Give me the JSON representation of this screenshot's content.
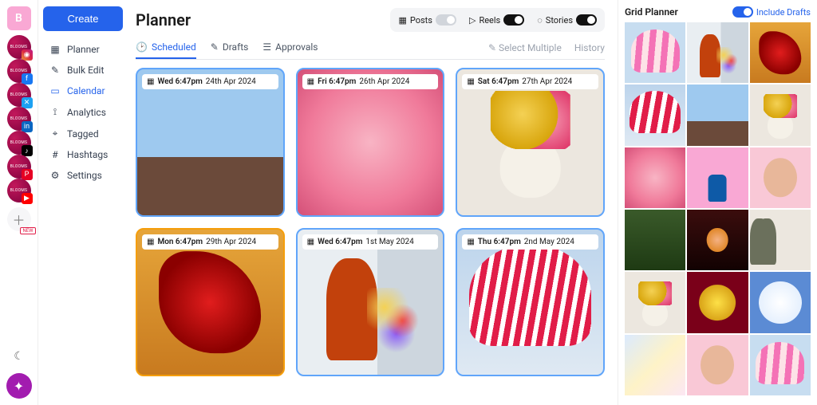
{
  "rail": {
    "avatar_letter": "B",
    "accounts": [
      {
        "name": "blooms-instagram",
        "net": "ig",
        "glyph": "◉"
      },
      {
        "name": "blooms-facebook",
        "net": "fb",
        "glyph": "f"
      },
      {
        "name": "blooms-twitter",
        "net": "tw",
        "glyph": "✕"
      },
      {
        "name": "blooms-linkedin",
        "net": "li",
        "glyph": "in"
      },
      {
        "name": "blooms-tiktok",
        "net": "tk",
        "glyph": "♪"
      },
      {
        "name": "blooms-pinterest",
        "net": "pi",
        "glyph": "P"
      },
      {
        "name": "blooms-youtube",
        "net": "yt",
        "glyph": "▶"
      }
    ],
    "add_badge": "NEW",
    "theme_glyph": "☾",
    "fab_glyph": "✦"
  },
  "sidebar": {
    "create_label": "Create",
    "items": [
      {
        "icon": "▦",
        "label": "Planner",
        "name": "nav-planner"
      },
      {
        "icon": "✎",
        "label": "Bulk Edit",
        "name": "nav-bulk-edit"
      },
      {
        "icon": "▭",
        "label": "Calendar",
        "name": "nav-calendar",
        "active": true
      },
      {
        "icon": "⟟",
        "label": "Analytics",
        "name": "nav-analytics"
      },
      {
        "icon": "⌖",
        "label": "Tagged",
        "name": "nav-tagged"
      },
      {
        "icon": "#",
        "label": "Hashtags",
        "name": "nav-hashtags"
      },
      {
        "icon": "⚙",
        "label": "Settings",
        "name": "nav-settings"
      }
    ]
  },
  "main": {
    "title": "Planner",
    "filters": [
      {
        "icon": "▦",
        "label": "Posts",
        "on": false,
        "name": "filter-posts"
      },
      {
        "icon": "▷",
        "label": "Reels",
        "on": true,
        "name": "filter-reels"
      },
      {
        "icon": "◌",
        "label": "Stories",
        "on": true,
        "name": "filter-stories"
      }
    ],
    "tabs": [
      {
        "icon": "🕑",
        "label": "Scheduled",
        "active": true,
        "name": "tab-scheduled"
      },
      {
        "icon": "✎",
        "label": "Drafts",
        "name": "tab-drafts"
      },
      {
        "icon": "☰",
        "label": "Approvals",
        "name": "tab-approvals"
      }
    ],
    "actions": {
      "select_multiple": "Select Multiple",
      "history": "History"
    },
    "posts": [
      {
        "time": "Wed 6:47pm",
        "date": "24th Apr 2024",
        "border": "#60a5fa",
        "tile": "fl-sky",
        "icon": "▦"
      },
      {
        "time": "Fri 6:47pm",
        "date": "26th Apr 2024",
        "border": "#60a5fa",
        "tile": "fl-pink",
        "icon": "▦"
      },
      {
        "time": "Sat 6:47pm",
        "date": "27th Apr 2024",
        "border": "#60a5fa",
        "tile": "fl-vase",
        "icon": "▦"
      },
      {
        "time": "Mon 6:47pm",
        "date": "29th Apr 2024",
        "border": "#f59e0b",
        "tile": "fl-red",
        "icon": "▦"
      },
      {
        "time": "Wed 6:47pm",
        "date": "1st May 2024",
        "border": "#60a5fa",
        "tile": "fl-person",
        "icon": "▦"
      },
      {
        "time": "Thu 6:47pm",
        "date": "2nd May 2024",
        "border": "#60a5fa",
        "tile": "fl-tulip",
        "icon": "▦"
      }
    ]
  },
  "grid_planner": {
    "title": "Grid Planner",
    "include_drafts": "Include Drafts",
    "cells": [
      "fl-ptulip",
      "fl-person",
      "fl-red",
      "fl-tulip",
      "fl-sky",
      "fl-vase",
      "fl-pink",
      "fl-pinkbg",
      "fl-face",
      "fl-hand",
      "fl-dark",
      "fl-pair",
      "fl-vase",
      "fl-yred",
      "fl-bluewhite",
      "fl-pastel",
      "fl-face",
      "fl-ptulip"
    ]
  }
}
